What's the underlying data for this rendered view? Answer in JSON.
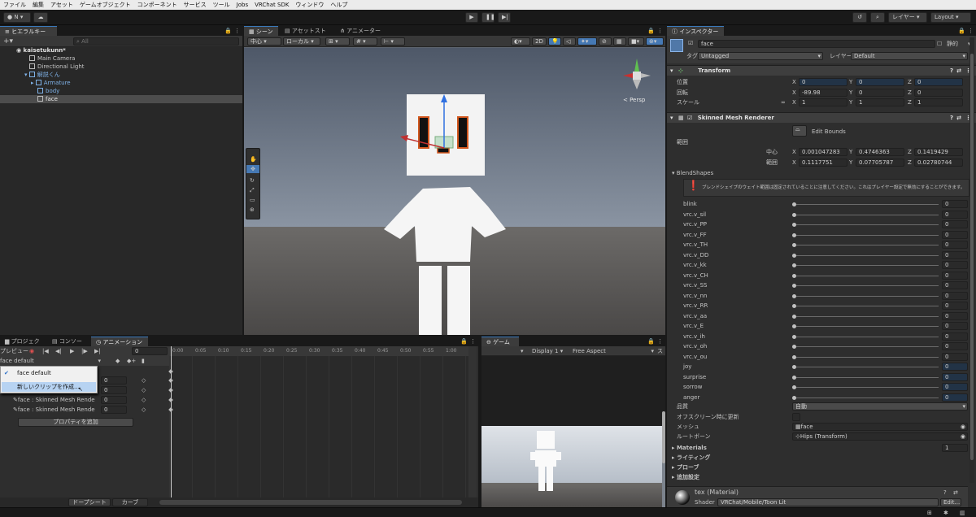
{
  "menu": [
    "ファイル",
    "編集",
    "アセット",
    "ゲームオブジェクト",
    "コンポーネント",
    "サービス",
    "ツール",
    "Jobs",
    "VRChat SDK",
    "ウィンドウ",
    "ヘルプ"
  ],
  "toolbar": {
    "account": "N",
    "layers": "レイヤー",
    "layout": "Layout"
  },
  "hierarchy": {
    "tab": "ヒエラルキー",
    "search_placeholder": "All",
    "scene": "kaisetukunn*",
    "items": [
      {
        "label": "Main Camera"
      },
      {
        "label": "Directional Light"
      },
      {
        "label": "解説くん"
      },
      {
        "label": "Armature"
      },
      {
        "label": "body"
      },
      {
        "label": "face"
      }
    ]
  },
  "scene_view": {
    "tabs": [
      "シーン",
      "アセットストア",
      "アニメーター"
    ],
    "pivot": "中心",
    "space": "ローカル",
    "mode_2d": "2D",
    "persp": "< Persp"
  },
  "bottom_left": {
    "tabs": [
      "プロジェクト",
      "コンソール",
      "アニメーション"
    ],
    "preview": "プレビュー",
    "frame": "0",
    "clip": "face default",
    "dropdown": {
      "item1": "face default",
      "item2": "新しいクリップを作成..."
    },
    "properties": [
      {
        "label": "face : Skinned Mesh Rende",
        "value": "0"
      },
      {
        "label": "face : Skinned Mesh Rende",
        "value": "0"
      }
    ],
    "prop_values_hidden": [
      "0",
      "0"
    ],
    "add_property": "プロパティを追加",
    "dopesheet": "ドープシート",
    "curves": "カーブ",
    "timeline": [
      "0:00",
      "0:05",
      "0:10",
      "0:15",
      "0:20",
      "0:25",
      "0:30",
      "0:35",
      "0:40",
      "0:45",
      "0:50",
      "0:55",
      "1:00"
    ]
  },
  "game": {
    "tab": "ゲーム",
    "display": "Display 1",
    "aspect": "Free Aspect",
    "scale": "ス"
  },
  "inspector": {
    "tab": "インスペクター",
    "name": "face",
    "static": "静的",
    "tag_label": "タグ",
    "tag": "Untagged",
    "layer_label": "レイヤー",
    "layer": "Default",
    "transform": {
      "title": "Transform",
      "pos_label": "位置",
      "rot_label": "回転",
      "scale_label": "スケール",
      "pos": [
        "0",
        "0",
        "0"
      ],
      "rot": [
        "-89.98",
        "0",
        "0"
      ],
      "scale": [
        "1",
        "1",
        "1"
      ]
    },
    "smr": {
      "title": "Skinned Mesh Renderer",
      "edit_bounds": "Edit Bounds",
      "bounds_label": "範囲",
      "center_label": "中心",
      "extent_label": "範囲",
      "center": [
        "0.001047283",
        "0.4746363",
        "0.1419429"
      ],
      "extent": [
        "0.1117751",
        "0.07705787",
        "0.02780744"
      ],
      "blendshapes_label": "BlendShapes",
      "warning": "ブレンドシェイプのウェイト範囲は固定されていることに注意してください。これはプレイヤー設定で無効にすることができます。",
      "blendshapes": [
        {
          "name": "blink",
          "value": "0"
        },
        {
          "name": "vrc.v_sil",
          "value": "0"
        },
        {
          "name": "vrc.v_PP",
          "value": "0"
        },
        {
          "name": "vrc.v_FF",
          "value": "0"
        },
        {
          "name": "vrc.v_TH",
          "value": "0"
        },
        {
          "name": "vrc.v_DD",
          "value": "0"
        },
        {
          "name": "vrc.v_kk",
          "value": "0"
        },
        {
          "name": "vrc.v_CH",
          "value": "0"
        },
        {
          "name": "vrc.v_SS",
          "value": "0"
        },
        {
          "name": "vrc.v_nn",
          "value": "0"
        },
        {
          "name": "vrc.v_RR",
          "value": "0"
        },
        {
          "name": "vrc.v_aa",
          "value": "0"
        },
        {
          "name": "vrc.v_E",
          "value": "0"
        },
        {
          "name": "vrc.v_ih",
          "value": "0"
        },
        {
          "name": "vrc.v_oh",
          "value": "0"
        },
        {
          "name": "vrc.v_ou",
          "value": "0"
        },
        {
          "name": "joy",
          "value": "0"
        },
        {
          "name": "surprise",
          "value": "0"
        },
        {
          "name": "sorrow",
          "value": "0"
        },
        {
          "name": "anger",
          "value": "0"
        }
      ],
      "quality_label": "品質",
      "quality": "自動",
      "offscreen_label": "オフスクリーン時に更新",
      "mesh_label": "メッシュ",
      "mesh": "face",
      "rootbone_label": "ルートボーン",
      "rootbone": "Hips (Transform)",
      "materials_label": "Materials",
      "materials_count": "1",
      "lighting": "ライティング",
      "probes": "プローブ",
      "additional": "追加設定"
    },
    "material": {
      "name": "tex (Material)",
      "shader_label": "Shader",
      "shader": "VRChat/Mobile/Toon Lit",
      "edit": "Edit..."
    }
  },
  "colors": {
    "accent": "#3a79bb",
    "selection": "#2c5d87",
    "panel": "#282828"
  }
}
